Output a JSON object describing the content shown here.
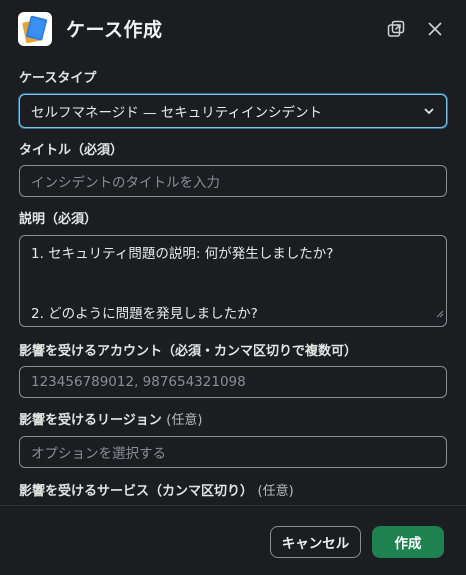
{
  "header": {
    "title": "ケース作成"
  },
  "fields": {
    "case_type": {
      "label": "ケースタイプ",
      "value": "セルフマネージド — セキュリティインシデント"
    },
    "title": {
      "label": "タイトル（必須）",
      "placeholder": "インシデントのタイトルを入力"
    },
    "description": {
      "label": "説明（必須）",
      "lines": [
        "1. セキュリティ問題の説明: 何が発生しましたか?",
        "",
        "",
        "2. どのように問題を発見しましたか?"
      ]
    },
    "accounts": {
      "label": "影響を受けるアカウント（必須・カンマ区切りで複数可）",
      "placeholder": "123456789012, 987654321098"
    },
    "regions": {
      "label": "影響を受けるリージョン",
      "optional": "(任意)",
      "placeholder": "オプションを選択する"
    },
    "services": {
      "label": "影響を受けるサービス（カンマ区切り）",
      "optional": "(任意)"
    }
  },
  "footer": {
    "cancel_label": "キャンセル",
    "create_label": "作成"
  },
  "colors": {
    "background": "#1b1d21",
    "focus_border": "#7ec3ea",
    "primary_button": "#1d8150"
  },
  "icons": [
    "notebook-icon",
    "popout-icon",
    "close-icon",
    "chevron-down-icon",
    "resize-handle-icon"
  ]
}
